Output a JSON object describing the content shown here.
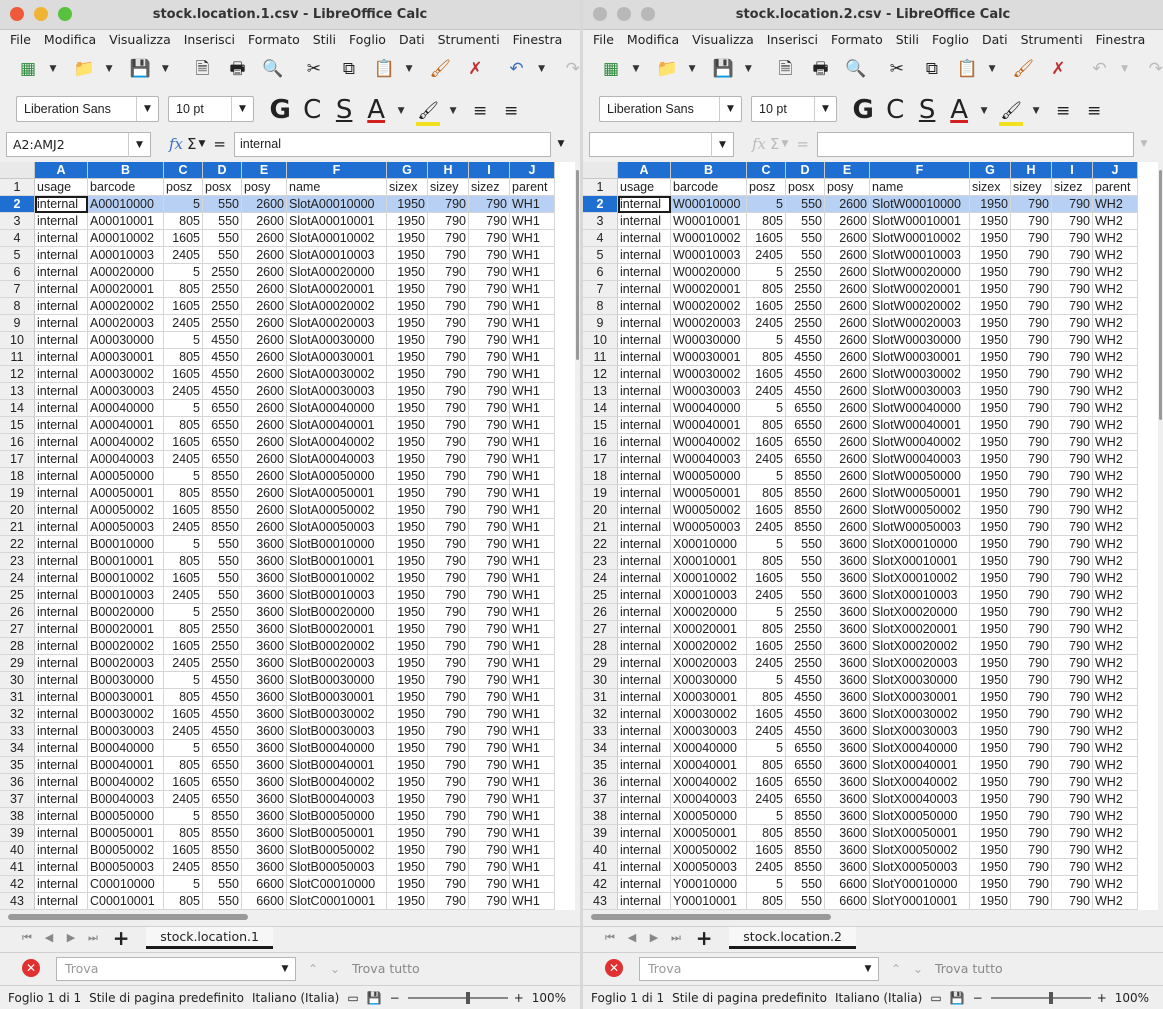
{
  "windows": [
    {
      "title": "stock.location.1.csv - LibreOffice Calc",
      "namebox": "A2:AMJ2",
      "formula": "internal",
      "sheet_tab": "stock.location.1",
      "active": true
    },
    {
      "title": "stock.location.2.csv - LibreOffice Calc",
      "namebox": "",
      "formula": "",
      "sheet_tab": "stock.location.2",
      "active": false
    }
  ],
  "menu": [
    "File",
    "Modifica",
    "Visualizza",
    "Inserisci",
    "Formato",
    "Stili",
    "Foglio",
    "Dati",
    "Strumenti",
    "Finestra"
  ],
  "font_name": "Liberation Sans",
  "font_size": "10 pt",
  "format_buttons": {
    "bold": "G",
    "italic": "C",
    "shadow": "S",
    "fontcolor": "A"
  },
  "columns": [
    "A",
    "B",
    "C",
    "D",
    "E",
    "F",
    "G",
    "H",
    "I",
    "J"
  ],
  "grid1": {
    "header": [
      "usage",
      "barcode",
      "posz",
      "posx",
      "posy",
      "name",
      "sizex",
      "sizey",
      "sizez",
      "parent"
    ],
    "rows": [
      [
        "internal",
        "A00010000",
        "5",
        "550",
        "2600",
        "SlotA00010000",
        "1950",
        "790",
        "790",
        "WH1"
      ],
      [
        "internal",
        "A00010001",
        "805",
        "550",
        "2600",
        "SlotA00010001",
        "1950",
        "790",
        "790",
        "WH1"
      ],
      [
        "internal",
        "A00010002",
        "1605",
        "550",
        "2600",
        "SlotA00010002",
        "1950",
        "790",
        "790",
        "WH1"
      ],
      [
        "internal",
        "A00010003",
        "2405",
        "550",
        "2600",
        "SlotA00010003",
        "1950",
        "790",
        "790",
        "WH1"
      ],
      [
        "internal",
        "A00020000",
        "5",
        "2550",
        "2600",
        "SlotA00020000",
        "1950",
        "790",
        "790",
        "WH1"
      ],
      [
        "internal",
        "A00020001",
        "805",
        "2550",
        "2600",
        "SlotA00020001",
        "1950",
        "790",
        "790",
        "WH1"
      ],
      [
        "internal",
        "A00020002",
        "1605",
        "2550",
        "2600",
        "SlotA00020002",
        "1950",
        "790",
        "790",
        "WH1"
      ],
      [
        "internal",
        "A00020003",
        "2405",
        "2550",
        "2600",
        "SlotA00020003",
        "1950",
        "790",
        "790",
        "WH1"
      ],
      [
        "internal",
        "A00030000",
        "5",
        "4550",
        "2600",
        "SlotA00030000",
        "1950",
        "790",
        "790",
        "WH1"
      ],
      [
        "internal",
        "A00030001",
        "805",
        "4550",
        "2600",
        "SlotA00030001",
        "1950",
        "790",
        "790",
        "WH1"
      ],
      [
        "internal",
        "A00030002",
        "1605",
        "4550",
        "2600",
        "SlotA00030002",
        "1950",
        "790",
        "790",
        "WH1"
      ],
      [
        "internal",
        "A00030003",
        "2405",
        "4550",
        "2600",
        "SlotA00030003",
        "1950",
        "790",
        "790",
        "WH1"
      ],
      [
        "internal",
        "A00040000",
        "5",
        "6550",
        "2600",
        "SlotA00040000",
        "1950",
        "790",
        "790",
        "WH1"
      ],
      [
        "internal",
        "A00040001",
        "805",
        "6550",
        "2600",
        "SlotA00040001",
        "1950",
        "790",
        "790",
        "WH1"
      ],
      [
        "internal",
        "A00040002",
        "1605",
        "6550",
        "2600",
        "SlotA00040002",
        "1950",
        "790",
        "790",
        "WH1"
      ],
      [
        "internal",
        "A00040003",
        "2405",
        "6550",
        "2600",
        "SlotA00040003",
        "1950",
        "790",
        "790",
        "WH1"
      ],
      [
        "internal",
        "A00050000",
        "5",
        "8550",
        "2600",
        "SlotA00050000",
        "1950",
        "790",
        "790",
        "WH1"
      ],
      [
        "internal",
        "A00050001",
        "805",
        "8550",
        "2600",
        "SlotA00050001",
        "1950",
        "790",
        "790",
        "WH1"
      ],
      [
        "internal",
        "A00050002",
        "1605",
        "8550",
        "2600",
        "SlotA00050002",
        "1950",
        "790",
        "790",
        "WH1"
      ],
      [
        "internal",
        "A00050003",
        "2405",
        "8550",
        "2600",
        "SlotA00050003",
        "1950",
        "790",
        "790",
        "WH1"
      ],
      [
        "internal",
        "B00010000",
        "5",
        "550",
        "3600",
        "SlotB00010000",
        "1950",
        "790",
        "790",
        "WH1"
      ],
      [
        "internal",
        "B00010001",
        "805",
        "550",
        "3600",
        "SlotB00010001",
        "1950",
        "790",
        "790",
        "WH1"
      ],
      [
        "internal",
        "B00010002",
        "1605",
        "550",
        "3600",
        "SlotB00010002",
        "1950",
        "790",
        "790",
        "WH1"
      ],
      [
        "internal",
        "B00010003",
        "2405",
        "550",
        "3600",
        "SlotB00010003",
        "1950",
        "790",
        "790",
        "WH1"
      ],
      [
        "internal",
        "B00020000",
        "5",
        "2550",
        "3600",
        "SlotB00020000",
        "1950",
        "790",
        "790",
        "WH1"
      ],
      [
        "internal",
        "B00020001",
        "805",
        "2550",
        "3600",
        "SlotB00020001",
        "1950",
        "790",
        "790",
        "WH1"
      ],
      [
        "internal",
        "B00020002",
        "1605",
        "2550",
        "3600",
        "SlotB00020002",
        "1950",
        "790",
        "790",
        "WH1"
      ],
      [
        "internal",
        "B00020003",
        "2405",
        "2550",
        "3600",
        "SlotB00020003",
        "1950",
        "790",
        "790",
        "WH1"
      ],
      [
        "internal",
        "B00030000",
        "5",
        "4550",
        "3600",
        "SlotB00030000",
        "1950",
        "790",
        "790",
        "WH1"
      ],
      [
        "internal",
        "B00030001",
        "805",
        "4550",
        "3600",
        "SlotB00030001",
        "1950",
        "790",
        "790",
        "WH1"
      ],
      [
        "internal",
        "B00030002",
        "1605",
        "4550",
        "3600",
        "SlotB00030002",
        "1950",
        "790",
        "790",
        "WH1"
      ],
      [
        "internal",
        "B00030003",
        "2405",
        "4550",
        "3600",
        "SlotB00030003",
        "1950",
        "790",
        "790",
        "WH1"
      ],
      [
        "internal",
        "B00040000",
        "5",
        "6550",
        "3600",
        "SlotB00040000",
        "1950",
        "790",
        "790",
        "WH1"
      ],
      [
        "internal",
        "B00040001",
        "805",
        "6550",
        "3600",
        "SlotB00040001",
        "1950",
        "790",
        "790",
        "WH1"
      ],
      [
        "internal",
        "B00040002",
        "1605",
        "6550",
        "3600",
        "SlotB00040002",
        "1950",
        "790",
        "790",
        "WH1"
      ],
      [
        "internal",
        "B00040003",
        "2405",
        "6550",
        "3600",
        "SlotB00040003",
        "1950",
        "790",
        "790",
        "WH1"
      ],
      [
        "internal",
        "B00050000",
        "5",
        "8550",
        "3600",
        "SlotB00050000",
        "1950",
        "790",
        "790",
        "WH1"
      ],
      [
        "internal",
        "B00050001",
        "805",
        "8550",
        "3600",
        "SlotB00050001",
        "1950",
        "790",
        "790",
        "WH1"
      ],
      [
        "internal",
        "B00050002",
        "1605",
        "8550",
        "3600",
        "SlotB00050002",
        "1950",
        "790",
        "790",
        "WH1"
      ],
      [
        "internal",
        "B00050003",
        "2405",
        "8550",
        "3600",
        "SlotB00050003",
        "1950",
        "790",
        "790",
        "WH1"
      ],
      [
        "internal",
        "C00010000",
        "5",
        "550",
        "6600",
        "SlotC00010000",
        "1950",
        "790",
        "790",
        "WH1"
      ],
      [
        "internal",
        "C00010001",
        "805",
        "550",
        "6600",
        "SlotC00010001",
        "1950",
        "790",
        "790",
        "WH1"
      ]
    ]
  },
  "grid2": {
    "header": [
      "usage",
      "barcode",
      "posz",
      "posx",
      "posy",
      "name",
      "sizex",
      "sizey",
      "sizez",
      "parent"
    ],
    "rows": [
      [
        "internal",
        "W00010000",
        "5",
        "550",
        "2600",
        "SlotW00010000",
        "1950",
        "790",
        "790",
        "WH2"
      ],
      [
        "internal",
        "W00010001",
        "805",
        "550",
        "2600",
        "SlotW00010001",
        "1950",
        "790",
        "790",
        "WH2"
      ],
      [
        "internal",
        "W00010002",
        "1605",
        "550",
        "2600",
        "SlotW00010002",
        "1950",
        "790",
        "790",
        "WH2"
      ],
      [
        "internal",
        "W00010003",
        "2405",
        "550",
        "2600",
        "SlotW00010003",
        "1950",
        "790",
        "790",
        "WH2"
      ],
      [
        "internal",
        "W00020000",
        "5",
        "2550",
        "2600",
        "SlotW00020000",
        "1950",
        "790",
        "790",
        "WH2"
      ],
      [
        "internal",
        "W00020001",
        "805",
        "2550",
        "2600",
        "SlotW00020001",
        "1950",
        "790",
        "790",
        "WH2"
      ],
      [
        "internal",
        "W00020002",
        "1605",
        "2550",
        "2600",
        "SlotW00020002",
        "1950",
        "790",
        "790",
        "WH2"
      ],
      [
        "internal",
        "W00020003",
        "2405",
        "2550",
        "2600",
        "SlotW00020003",
        "1950",
        "790",
        "790",
        "WH2"
      ],
      [
        "internal",
        "W00030000",
        "5",
        "4550",
        "2600",
        "SlotW00030000",
        "1950",
        "790",
        "790",
        "WH2"
      ],
      [
        "internal",
        "W00030001",
        "805",
        "4550",
        "2600",
        "SlotW00030001",
        "1950",
        "790",
        "790",
        "WH2"
      ],
      [
        "internal",
        "W00030002",
        "1605",
        "4550",
        "2600",
        "SlotW00030002",
        "1950",
        "790",
        "790",
        "WH2"
      ],
      [
        "internal",
        "W00030003",
        "2405",
        "4550",
        "2600",
        "SlotW00030003",
        "1950",
        "790",
        "790",
        "WH2"
      ],
      [
        "internal",
        "W00040000",
        "5",
        "6550",
        "2600",
        "SlotW00040000",
        "1950",
        "790",
        "790",
        "WH2"
      ],
      [
        "internal",
        "W00040001",
        "805",
        "6550",
        "2600",
        "SlotW00040001",
        "1950",
        "790",
        "790",
        "WH2"
      ],
      [
        "internal",
        "W00040002",
        "1605",
        "6550",
        "2600",
        "SlotW00040002",
        "1950",
        "790",
        "790",
        "WH2"
      ],
      [
        "internal",
        "W00040003",
        "2405",
        "6550",
        "2600",
        "SlotW00040003",
        "1950",
        "790",
        "790",
        "WH2"
      ],
      [
        "internal",
        "W00050000",
        "5",
        "8550",
        "2600",
        "SlotW00050000",
        "1950",
        "790",
        "790",
        "WH2"
      ],
      [
        "internal",
        "W00050001",
        "805",
        "8550",
        "2600",
        "SlotW00050001",
        "1950",
        "790",
        "790",
        "WH2"
      ],
      [
        "internal",
        "W00050002",
        "1605",
        "8550",
        "2600",
        "SlotW00050002",
        "1950",
        "790",
        "790",
        "WH2"
      ],
      [
        "internal",
        "W00050003",
        "2405",
        "8550",
        "2600",
        "SlotW00050003",
        "1950",
        "790",
        "790",
        "WH2"
      ],
      [
        "internal",
        "X00010000",
        "5",
        "550",
        "3600",
        "SlotX00010000",
        "1950",
        "790",
        "790",
        "WH2"
      ],
      [
        "internal",
        "X00010001",
        "805",
        "550",
        "3600",
        "SlotX00010001",
        "1950",
        "790",
        "790",
        "WH2"
      ],
      [
        "internal",
        "X00010002",
        "1605",
        "550",
        "3600",
        "SlotX00010002",
        "1950",
        "790",
        "790",
        "WH2"
      ],
      [
        "internal",
        "X00010003",
        "2405",
        "550",
        "3600",
        "SlotX00010003",
        "1950",
        "790",
        "790",
        "WH2"
      ],
      [
        "internal",
        "X00020000",
        "5",
        "2550",
        "3600",
        "SlotX00020000",
        "1950",
        "790",
        "790",
        "WH2"
      ],
      [
        "internal",
        "X00020001",
        "805",
        "2550",
        "3600",
        "SlotX00020001",
        "1950",
        "790",
        "790",
        "WH2"
      ],
      [
        "internal",
        "X00020002",
        "1605",
        "2550",
        "3600",
        "SlotX00020002",
        "1950",
        "790",
        "790",
        "WH2"
      ],
      [
        "internal",
        "X00020003",
        "2405",
        "2550",
        "3600",
        "SlotX00020003",
        "1950",
        "790",
        "790",
        "WH2"
      ],
      [
        "internal",
        "X00030000",
        "5",
        "4550",
        "3600",
        "SlotX00030000",
        "1950",
        "790",
        "790",
        "WH2"
      ],
      [
        "internal",
        "X00030001",
        "805",
        "4550",
        "3600",
        "SlotX00030001",
        "1950",
        "790",
        "790",
        "WH2"
      ],
      [
        "internal",
        "X00030002",
        "1605",
        "4550",
        "3600",
        "SlotX00030002",
        "1950",
        "790",
        "790",
        "WH2"
      ],
      [
        "internal",
        "X00030003",
        "2405",
        "4550",
        "3600",
        "SlotX00030003",
        "1950",
        "790",
        "790",
        "WH2"
      ],
      [
        "internal",
        "X00040000",
        "5",
        "6550",
        "3600",
        "SlotX00040000",
        "1950",
        "790",
        "790",
        "WH2"
      ],
      [
        "internal",
        "X00040001",
        "805",
        "6550",
        "3600",
        "SlotX00040001",
        "1950",
        "790",
        "790",
        "WH2"
      ],
      [
        "internal",
        "X00040002",
        "1605",
        "6550",
        "3600",
        "SlotX00040002",
        "1950",
        "790",
        "790",
        "WH2"
      ],
      [
        "internal",
        "X00040003",
        "2405",
        "6550",
        "3600",
        "SlotX00040003",
        "1950",
        "790",
        "790",
        "WH2"
      ],
      [
        "internal",
        "X00050000",
        "5",
        "8550",
        "3600",
        "SlotX00050000",
        "1950",
        "790",
        "790",
        "WH2"
      ],
      [
        "internal",
        "X00050001",
        "805",
        "8550",
        "3600",
        "SlotX00050001",
        "1950",
        "790",
        "790",
        "WH2"
      ],
      [
        "internal",
        "X00050002",
        "1605",
        "8550",
        "3600",
        "SlotX00050002",
        "1950",
        "790",
        "790",
        "WH2"
      ],
      [
        "internal",
        "X00050003",
        "2405",
        "8550",
        "3600",
        "SlotX00050003",
        "1950",
        "790",
        "790",
        "WH2"
      ],
      [
        "internal",
        "Y00010000",
        "5",
        "550",
        "6600",
        "SlotY00010000",
        "1950",
        "790",
        "790",
        "WH2"
      ],
      [
        "internal",
        "Y00010001",
        "805",
        "550",
        "6600",
        "SlotY00010001",
        "1950",
        "790",
        "790",
        "WH2"
      ]
    ]
  },
  "find": {
    "placeholder": "Trova",
    "find_all": "Trova tutto"
  },
  "status": {
    "sheet": "Foglio 1 di 1",
    "page_style": "Stile di pagina predefinito",
    "language": "Italiano (Italia)",
    "zoom": "100%"
  },
  "colors": {
    "accent": "#1f6fd3",
    "selection": "#b7d0f3",
    "close_red": "#e03030"
  }
}
